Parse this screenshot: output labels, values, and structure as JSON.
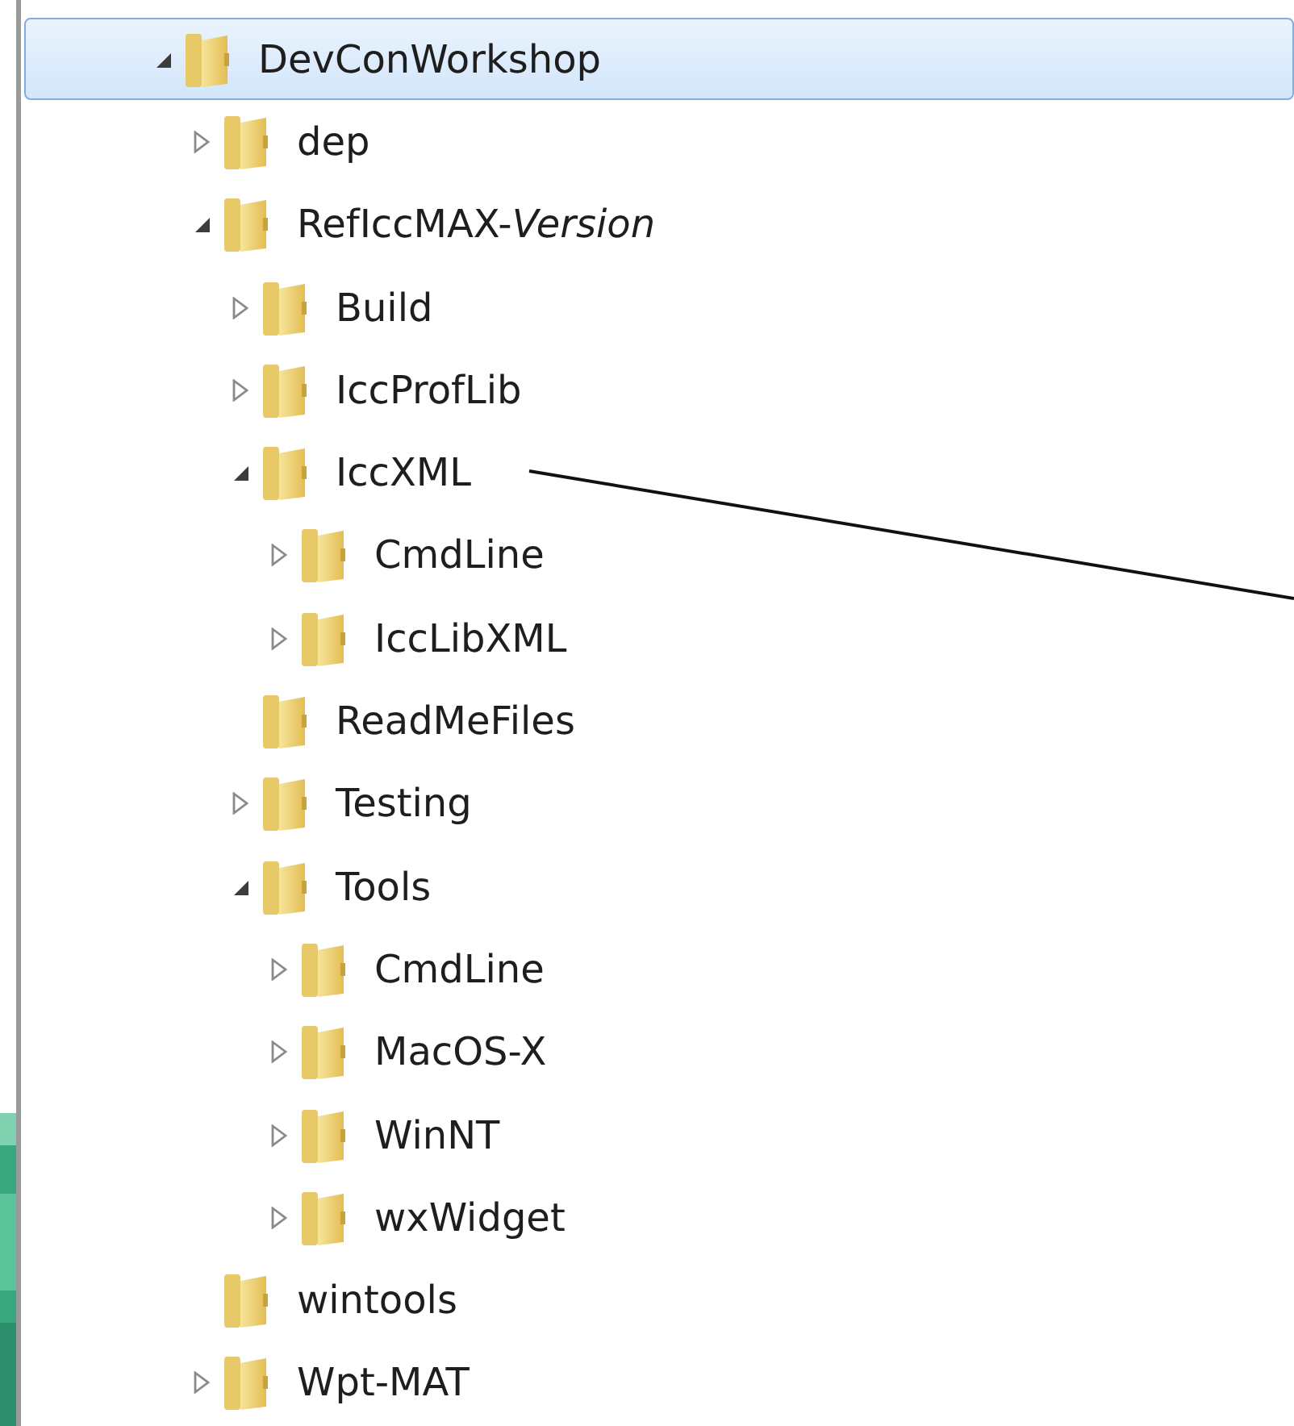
{
  "tree": [
    {
      "label": "DevConWorkshop",
      "selected": true,
      "expanded": true,
      "children": [
        {
          "label": "dep",
          "selected": false,
          "expanded": false
        },
        {
          "label": "RefIccMAX-*Version*",
          "selected": false,
          "expanded": true,
          "children": [
            {
              "label": "Build",
              "selected": false,
              "expanded": false
            },
            {
              "label": "IccProfLib",
              "selected": false,
              "expanded": false
            },
            {
              "label": "IccXML",
              "selected": false,
              "expanded": true,
              "children": [
                {
                  "label": "CmdLine",
                  "selected": false,
                  "expanded": false
                },
                {
                  "label": "IccLibXML",
                  "selected": false,
                  "expanded": false
                }
              ]
            },
            {
              "label": "ReadMeFiles",
              "selected": false
            },
            {
              "label": "Testing",
              "selected": false,
              "expanded": false
            },
            {
              "label": "Tools",
              "selected": false,
              "expanded": true,
              "children": [
                {
                  "label": "CmdLine",
                  "selected": false,
                  "expanded": false
                },
                {
                  "label": "MacOS-X",
                  "selected": false,
                  "expanded": false
                },
                {
                  "label": "WinNT",
                  "selected": false,
                  "expanded": false
                },
                {
                  "label": "wxWidget",
                  "selected": false,
                  "expanded": false
                }
              ]
            }
          ]
        },
        {
          "label": "wintools",
          "selected": false
        },
        {
          "label": "Wpt-MAT",
          "selected": false,
          "expanded": false
        }
      ]
    }
  ]
}
